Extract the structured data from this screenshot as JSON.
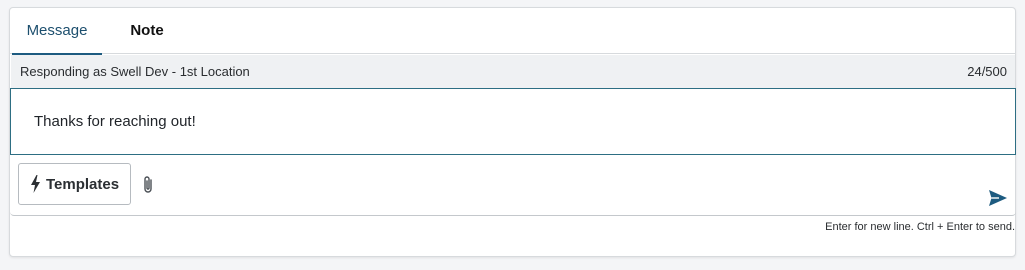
{
  "tabs": [
    {
      "label": "Message",
      "active": true
    },
    {
      "label": "Note",
      "active": false
    }
  ],
  "responding": {
    "label": "Responding as Swell Dev - 1st Location",
    "char_count": "24/500"
  },
  "editor": {
    "value": "Thanks for reaching out!"
  },
  "toolbar": {
    "templates_label": "Templates",
    "templates_icon": "lightning-icon",
    "attach_icon": "paperclip-icon",
    "send_icon": "send-icon"
  },
  "hint": "Enter for new line. Ctrl + Enter to send.",
  "colors": {
    "accent": "#1d5b80",
    "editor_border": "#2d6e83",
    "respond_bar_bg": "#eff1f3"
  }
}
